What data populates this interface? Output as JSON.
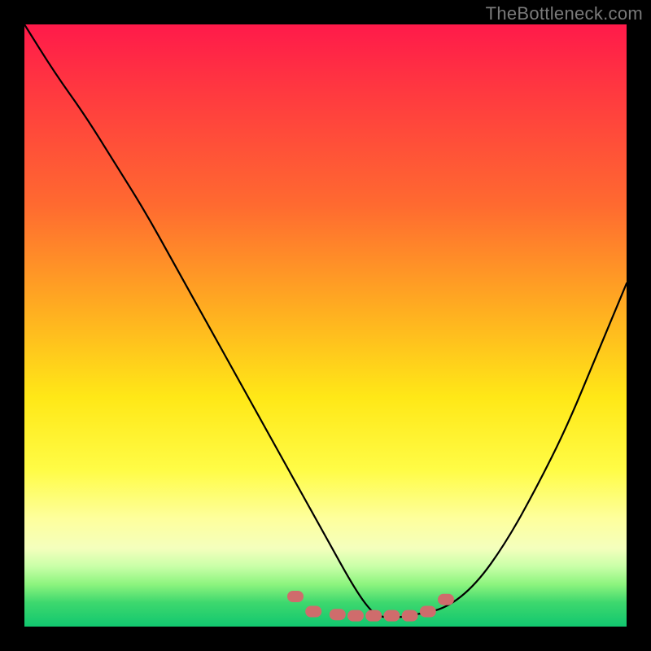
{
  "watermark": "TheBottleneck.com",
  "chart_data": {
    "type": "line",
    "title": "",
    "xlabel": "",
    "ylabel": "",
    "xlim": [
      0,
      100
    ],
    "ylim": [
      0,
      100
    ],
    "grid": false,
    "legend": false,
    "series": [
      {
        "name": "curve",
        "color": "#000000",
        "x": [
          0,
          5,
          10,
          15,
          20,
          25,
          30,
          35,
          40,
          45,
          50,
          55,
          58,
          60,
          62,
          65,
          70,
          75,
          80,
          85,
          90,
          95,
          100
        ],
        "y": [
          100,
          92,
          85,
          77,
          69,
          60,
          51,
          42,
          33,
          24,
          15,
          6,
          2,
          1.5,
          1.5,
          2,
          3,
          7,
          14,
          23,
          33,
          45,
          57
        ]
      }
    ],
    "markers": {
      "name": "bottom-markers",
      "shape": "rounded-capsule",
      "color": "#cf6c6c",
      "x": [
        45,
        48,
        52,
        55,
        58,
        61,
        64,
        67,
        70
      ],
      "y": [
        5,
        2.5,
        2,
        1.8,
        1.8,
        1.8,
        1.8,
        2.5,
        4.5
      ]
    },
    "background_gradient": {
      "top": "#ff1a4a",
      "mid_high": "#ffb020",
      "mid": "#ffe817",
      "mid_low": "#feff9c",
      "low": "#3ed86e",
      "bottom": "#11c76f"
    }
  }
}
